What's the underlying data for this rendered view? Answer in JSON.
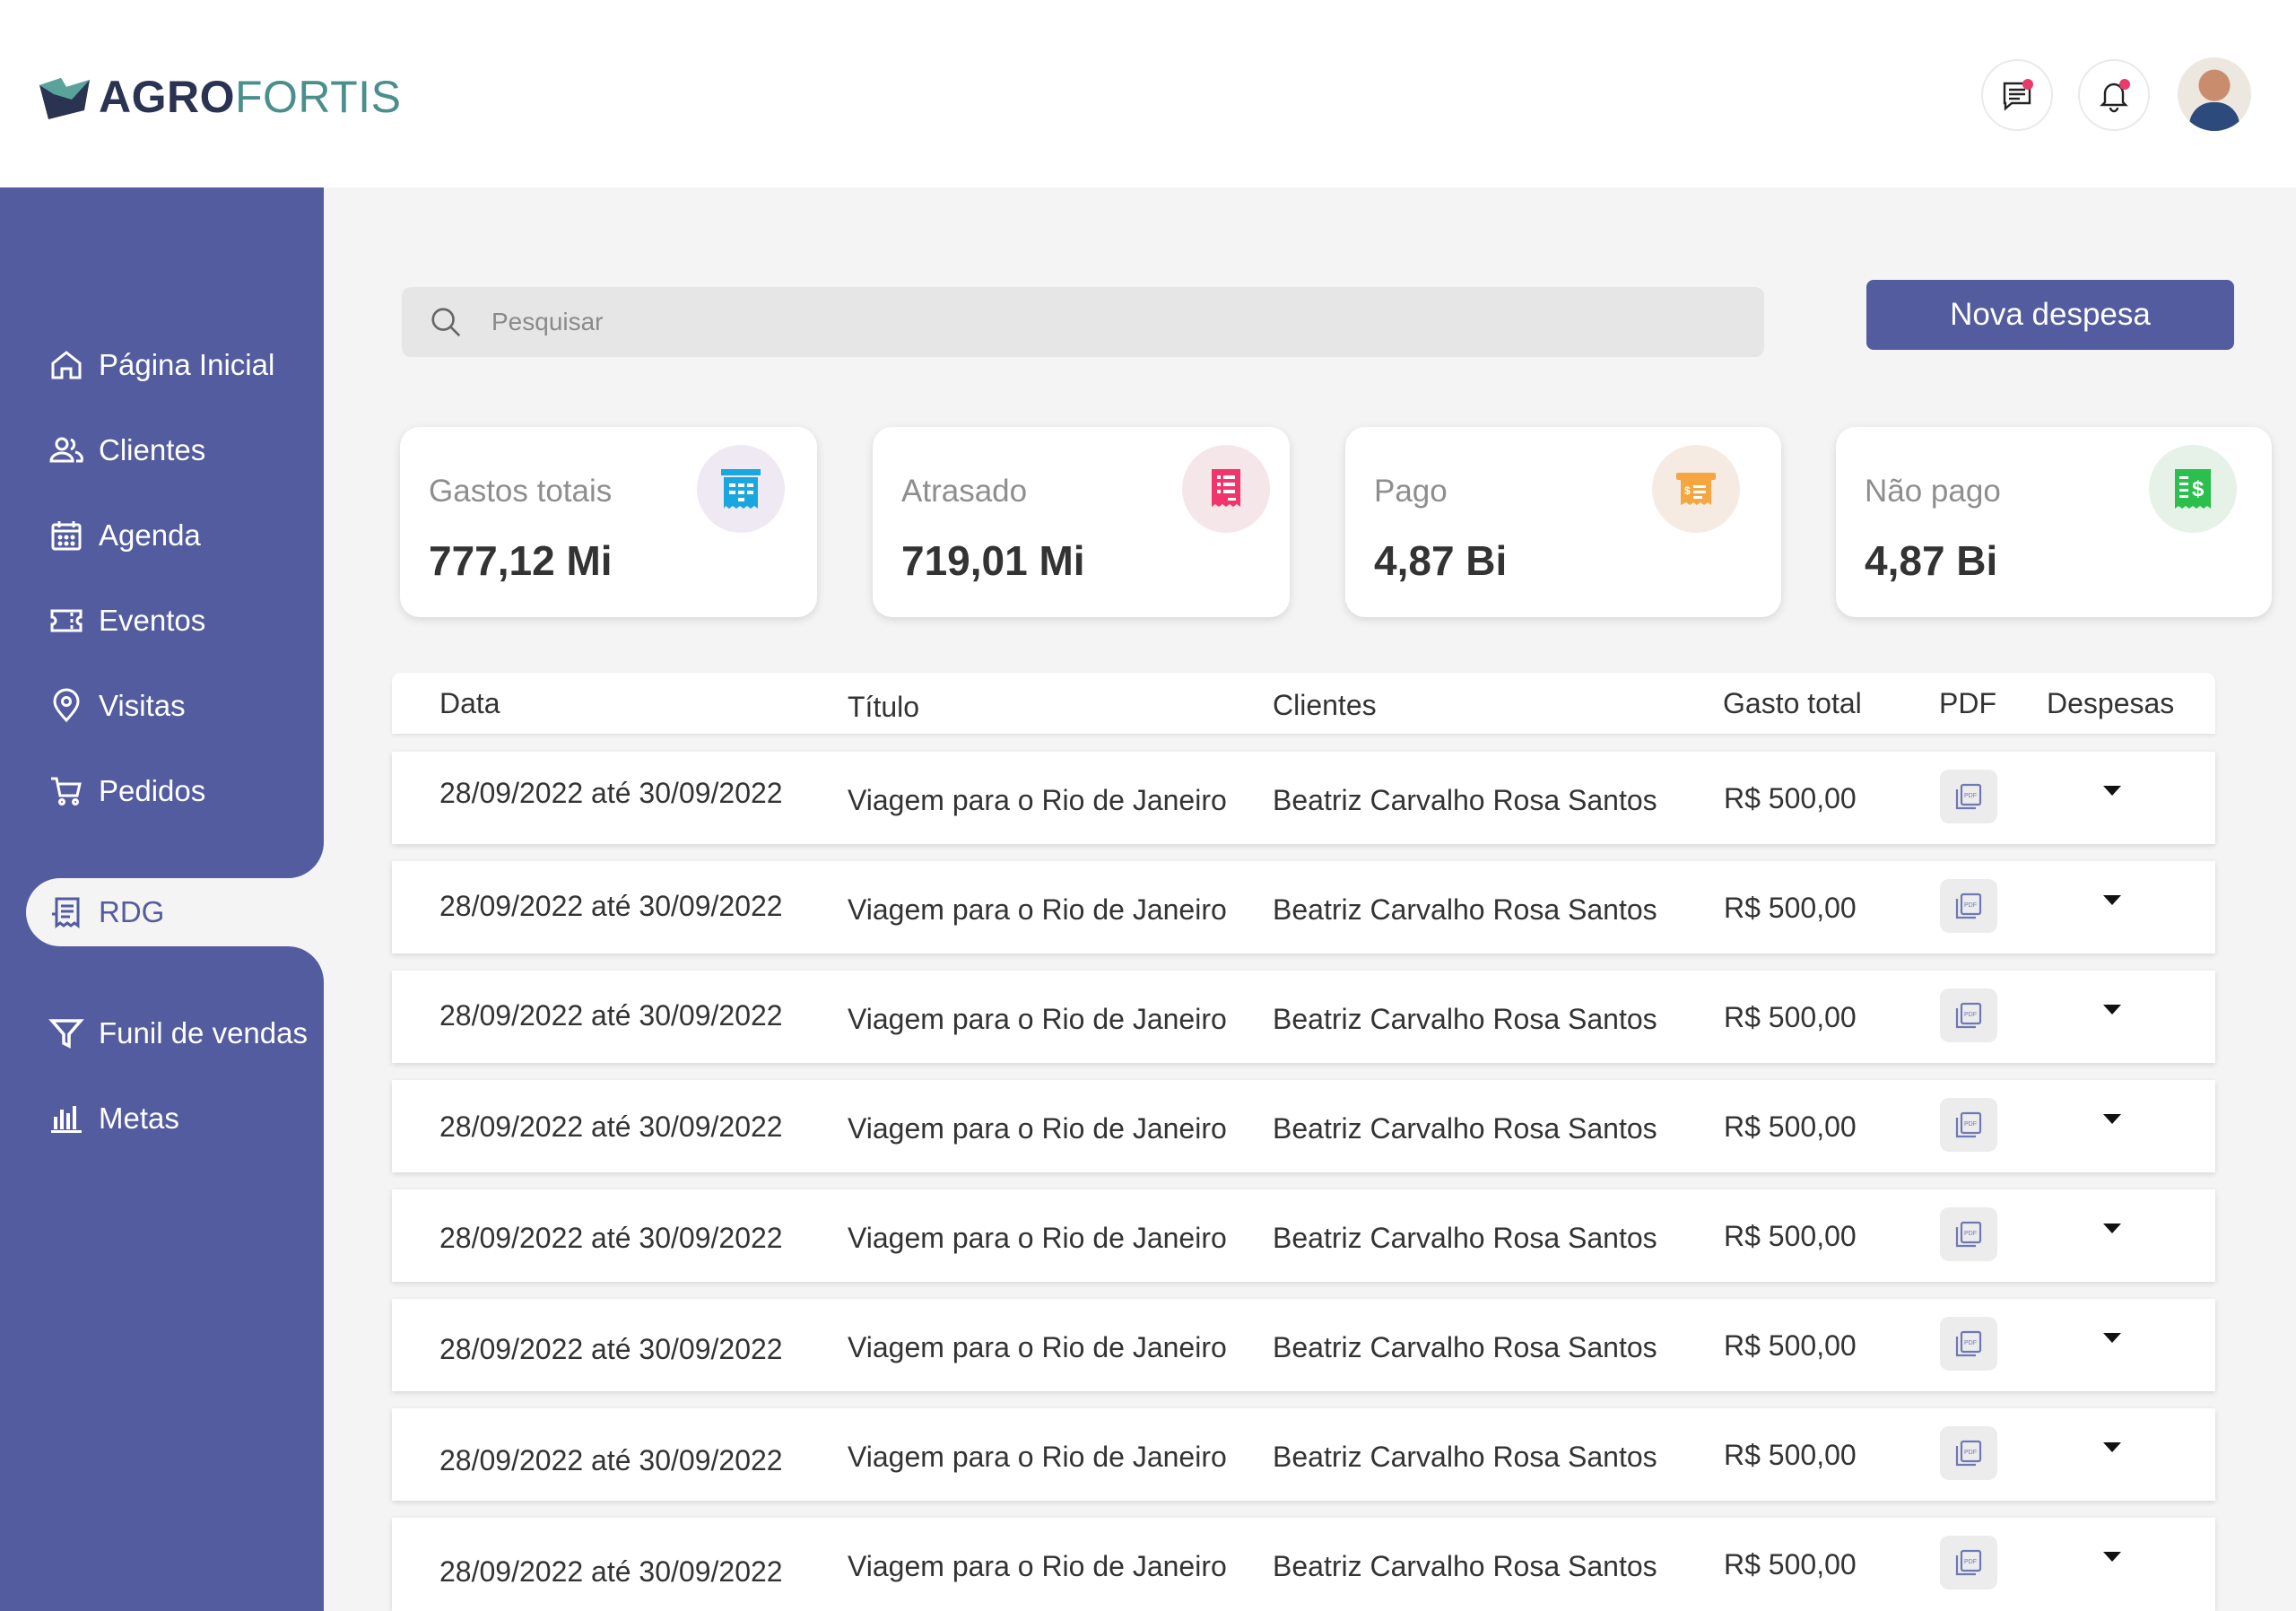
{
  "brand": {
    "name_bold": "AGRO",
    "name_light": "FORTIS"
  },
  "header": {
    "messages_icon": "chat-icon",
    "notifications_icon": "bell-icon"
  },
  "sidebar": {
    "items": [
      {
        "label": "Página Inicial",
        "icon": "home-icon"
      },
      {
        "label": "Clientes",
        "icon": "users-icon"
      },
      {
        "label": "Agenda",
        "icon": "calendar-icon"
      },
      {
        "label": "Eventos",
        "icon": "ticket-icon"
      },
      {
        "label": "Visitas",
        "icon": "location-pin-icon"
      },
      {
        "label": "Pedidos",
        "icon": "cart-icon"
      },
      {
        "label": "RDG",
        "icon": "receipt-icon",
        "active": true
      },
      {
        "label": "Funil de vendas",
        "icon": "funnel-icon"
      },
      {
        "label": "Metas",
        "icon": "bar-chart-icon"
      }
    ]
  },
  "search": {
    "placeholder": "Pesquisar"
  },
  "actions": {
    "new_expense": "Nova despesa"
  },
  "stats": [
    {
      "label": "Gastos totais",
      "value": "777,12 Mi",
      "icon": "building-receipt-icon",
      "color": "#1aa7e0",
      "bg": "#efe9f3"
    },
    {
      "label": "Atrasado",
      "value": "719,01 Mi",
      "icon": "invoice-icon",
      "color": "#f0356c",
      "bg": "#f5e6ea"
    },
    {
      "label": "Pago",
      "value": "4,87 Bi",
      "icon": "bill-icon",
      "color": "#f5a640",
      "bg": "#f5ebe3"
    },
    {
      "label": "Não pago",
      "value": "4,87 Bi",
      "icon": "money-receipt-icon",
      "color": "#2bc04e",
      "bg": "#e6f1e8"
    }
  ],
  "table": {
    "columns": [
      "Data",
      "Título",
      "Clientes",
      "Gasto total",
      "PDF",
      "Despesas"
    ],
    "rows": [
      {
        "date": "28/09/2022 até 30/09/2022",
        "title": "Viagem para o Rio de Janeiro",
        "client": "Beatriz Carvalho Rosa Santos",
        "total": "R$ 500,00"
      },
      {
        "date": "28/09/2022 até 30/09/2022",
        "title": "Viagem para o Rio de Janeiro",
        "client": "Beatriz Carvalho Rosa Santos",
        "total": "R$ 500,00"
      },
      {
        "date": "28/09/2022 até 30/09/2022",
        "title": "Viagem para o Rio de Janeiro",
        "client": "Beatriz Carvalho Rosa Santos",
        "total": "R$ 500,00"
      },
      {
        "date": "28/09/2022 até 30/09/2022",
        "title": "Viagem para o Rio de Janeiro",
        "client": "Beatriz Carvalho Rosa Santos",
        "total": "R$ 500,00"
      },
      {
        "date": "28/09/2022 até 30/09/2022",
        "title": "Viagem para o Rio de Janeiro",
        "client": "Beatriz Carvalho Rosa Santos",
        "total": "R$ 500,00"
      },
      {
        "date": "28/09/2022 até 30/09/2022",
        "title": "Viagem para o Rio de Janeiro",
        "client": "Beatriz Carvalho Rosa Santos",
        "total": "R$ 500,00"
      },
      {
        "date": "28/09/2022 até 30/09/2022",
        "title": "Viagem para o Rio de Janeiro",
        "client": "Beatriz Carvalho Rosa Santos",
        "total": "R$ 500,00"
      },
      {
        "date": "28/09/2022 até 30/09/2022",
        "title": "Viagem para o Rio de Janeiro",
        "client": "Beatriz Carvalho Rosa Santos",
        "total": "R$ 500,00"
      }
    ]
  },
  "colors": {
    "primary": "#525c9f",
    "background": "#f4f4f4",
    "brand_dark": "#2b3352",
    "brand_teal": "#4a8f8c"
  }
}
